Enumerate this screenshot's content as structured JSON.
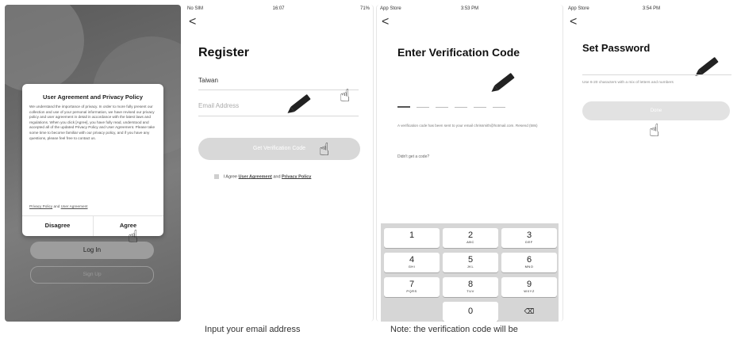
{
  "screen1": {
    "dialog_title": "User Agreement and Privacy Policy",
    "dialog_body": "We understand the importance of privacy. In order to more fully present our collection and use of your personal information, we have revised our privacy policy and user agreement in detail in accordance with the latest laws and regulations. When you click [Agree], you have fully read, understood and accepted all of the updated Privacy Policy and User Agreement. Please take some time to become familiar with our privacy policy, and if you have any questions, please feel free to contact us.",
    "link_privacy": "Privacy Policy",
    "link_and": "and",
    "link_user": "User Agreement",
    "disagree": "Disagree",
    "agree": "Agree",
    "login": "Log In",
    "signup": "Sign Up"
  },
  "screen2": {
    "status_left": "No SIM",
    "status_time": "16:07",
    "status_right": "71%",
    "back": "<",
    "title": "Register",
    "region": "Taiwan",
    "email_placeholder": "Email Address",
    "get_code": "Get Verification Code",
    "agree_prefix": "I Agree",
    "agree_user": "User Agreement",
    "agree_and": "and",
    "agree_privacy": "Privacy Policy"
  },
  "screen3": {
    "status_left": "App Store",
    "status_time": "3:53 PM",
    "back": "<",
    "title": "Enter Verification Code",
    "sent_note": "A verification code has been sent to your email chrissmith@hotmail.com. Resend (58s)",
    "didnt_get": "Didn't get a code?",
    "keys": [
      {
        "n": "1",
        "a": ""
      },
      {
        "n": "2",
        "a": "ABC"
      },
      {
        "n": "3",
        "a": "DEF"
      },
      {
        "n": "4",
        "a": "GHI"
      },
      {
        "n": "5",
        "a": "JKL"
      },
      {
        "n": "6",
        "a": "MNO"
      },
      {
        "n": "7",
        "a": "PQRS"
      },
      {
        "n": "8",
        "a": "TUV"
      },
      {
        "n": "9",
        "a": "WXYZ"
      },
      {
        "n": "",
        "a": ""
      },
      {
        "n": "0",
        "a": ""
      },
      {
        "n": "⌫",
        "a": ""
      }
    ]
  },
  "screen4": {
    "status_left": "App Store",
    "status_time": "3:54 PM",
    "back": "<",
    "title": "Set Password",
    "hint": "Use 6-20 characters with a mix of letters and numbers",
    "done": "Done"
  },
  "captions": {
    "c2": "Input your email address",
    "c3": "Note: the verification code will be"
  },
  "icons": {
    "pen": "pen-icon",
    "hand": "pointing-hand-icon"
  },
  "colors": {
    "button_grey": "#d8d8d8",
    "login_grey": "#9d9d9d"
  }
}
